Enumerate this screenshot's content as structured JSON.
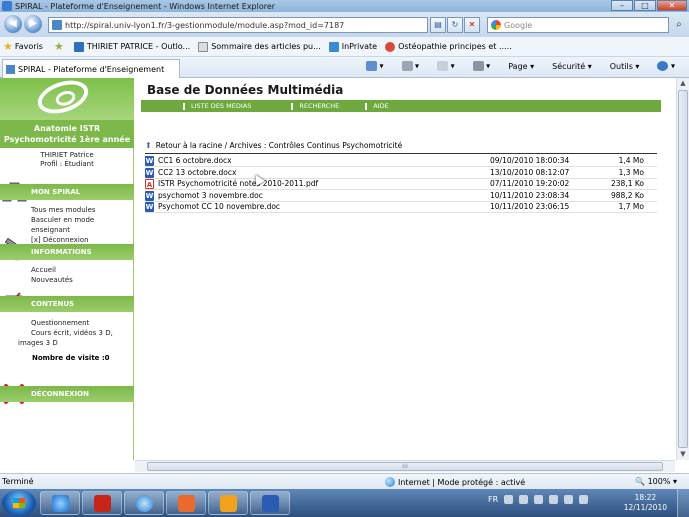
{
  "window": {
    "title": "SPIRAL - Plateforme d'Enseignement - Windows Internet Explorer",
    "controls": {
      "minimize": "–",
      "maximize": "□",
      "close": "✕"
    }
  },
  "address_bar": {
    "url": "http://spiral.univ-lyon1.fr/3-gestionmodule/module.asp?mod_id=7187",
    "search_placeholder": "Google"
  },
  "favorites_bar": {
    "label": "Favoris",
    "items": [
      "THIRIET PATRICE - Outlo...",
      "Sommaire des articles pu...",
      "InPrivate",
      "Ostéopathie principes et ....."
    ]
  },
  "tab": {
    "label": "SPIRAL - Plateforme d'Enseignement"
  },
  "command_bar": {
    "page": "Page",
    "safety": "Sécurité",
    "tools": "Outils"
  },
  "sidebar": {
    "course_line1": "Anatomie ISTR",
    "course_line2": "Psychomotricité 1ère année",
    "user_name": "THIRIET Patrice",
    "user_profile": "Profil : Étudiant",
    "sections": [
      {
        "title": "MON SPIRAL",
        "links": [
          "Tous mes modules",
          "Basculer en mode enseignant",
          "[x]  Déconnexion"
        ]
      },
      {
        "title": "INFORMATIONS GÉNÉRALES",
        "links": [
          "Accueil",
          "Nouveautés"
        ]
      },
      {
        "title": "CONTENUS PÉDAGOGIQUES",
        "links": [
          "Questionnement",
          "Cours écrit, vidéos 3 D,",
          "images 3 D"
        ]
      },
      {
        "title": "DÉCONNEXION",
        "links": []
      }
    ],
    "visits": "Nombre de visite :0"
  },
  "main": {
    "title": "Base de Données Multimédia",
    "menu": [
      "LISTE DES MEDIAS",
      "RECHERCHE",
      "AIDE"
    ],
    "breadcrumb": "Retour à la racine / Archives : Contrôles Continus Psychomotricité",
    "files": [
      {
        "type": "word",
        "name": "CC1 6 octobre.docx",
        "date": "09/10/2010 18:00:34",
        "size": "1,4 Mo"
      },
      {
        "type": "word",
        "name": "CC2 13 octobre.docx",
        "date": "13/10/2010 08:12:07",
        "size": "1,3 Mo"
      },
      {
        "type": "pdf",
        "name": "ISTR Psychomotricité notes 2010-2011.pdf",
        "date": "07/11/2010 19:20:02",
        "size": "238,1 Ko"
      },
      {
        "type": "word",
        "name": "psychomot 3 novembre.doc",
        "date": "10/11/2010 23:08:34",
        "size": "988,2 Ko"
      },
      {
        "type": "word",
        "name": "Psychomot CC 10 novembre.doc",
        "date": "10/11/2010 23:06:15",
        "size": "1,7 Mo"
      }
    ]
  },
  "status_bar": {
    "status": "Terminé",
    "zone": "Internet | Mode protégé : activé",
    "zoom": "100%"
  },
  "taskbar": {
    "language": "FR",
    "time": "18:22",
    "date": "12/11/2010"
  }
}
